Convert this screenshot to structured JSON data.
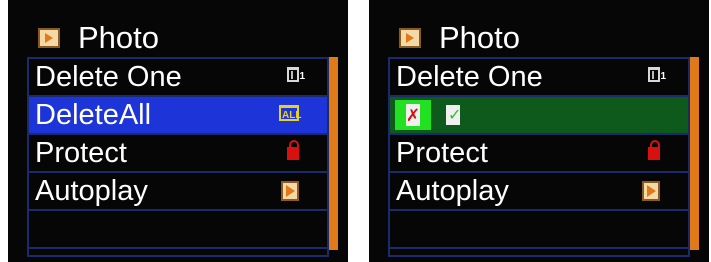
{
  "screens": [
    {
      "header": {
        "title": "Photo",
        "icon": "photo-icon"
      },
      "items": [
        {
          "label": "Delete One",
          "icon": "trash-icon",
          "tag": "1"
        },
        {
          "label": "DeleteAll",
          "icon": "trash-all-icon",
          "tag": "ALL",
          "selected": true
        },
        {
          "label": "Protect",
          "icon": "lock-icon"
        },
        {
          "label": "Autoplay",
          "icon": "play-icon"
        }
      ]
    },
    {
      "header": {
        "title": "Photo",
        "icon": "photo-icon"
      },
      "items": [
        {
          "label": "Delete One",
          "icon": "trash-icon",
          "tag": "1"
        },
        {
          "label": "",
          "confirm": {
            "yes_icon": "delete-file-icon",
            "yes_mark": "✗",
            "no_icon": "keep-file-icon",
            "no_mark": "✓"
          }
        },
        {
          "label": "Protect",
          "icon": "lock-icon"
        },
        {
          "label": "Autoplay",
          "icon": "play-icon"
        }
      ]
    }
  ],
  "colors": {
    "highlight": "#1c34d8",
    "confirm_row": "#0e5a1c",
    "accent": "#e07a18",
    "border": "#1a2a6a"
  }
}
